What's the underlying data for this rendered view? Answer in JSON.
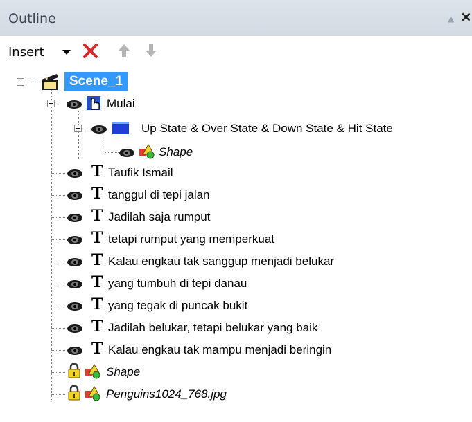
{
  "panel": {
    "title": "Outline"
  },
  "toolbar": {
    "insert_label": "Insert"
  },
  "tree": {
    "scene": "Scene_1",
    "button": "Mulai",
    "states": "Up State & Over State & Down State & Hit State",
    "shape_child": "Shape",
    "texts": [
      "Taufik Ismail",
      "tanggul di tepi jalan",
      "Jadilah saja rumput",
      "tetapi rumput yang memperkuat",
      "Kalau engkau tak sanggup menjadi belukar",
      "yang tumbuh di tepi danau",
      "yang tegak di puncak bukit",
      "Jadilah belukar, tetapi belukar yang baik",
      "Kalau engkau tak mampu menjadi beringin"
    ],
    "locked_shape": "Shape",
    "locked_image": "Penguins1024_768.jpg"
  },
  "colors": {
    "selection": "#3399ff",
    "header": "#d8dee6"
  }
}
